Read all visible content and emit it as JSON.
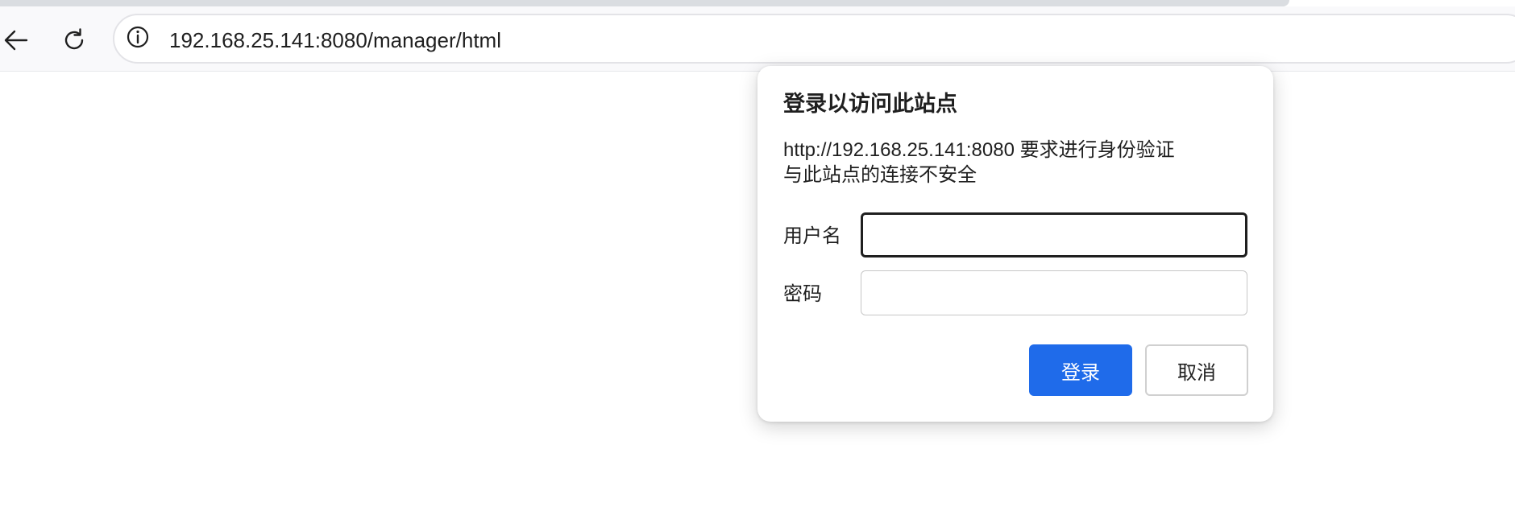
{
  "toolbar": {
    "back_icon": "back-arrow-icon",
    "reload_icon": "reload-icon",
    "site_info_icon": "info-icon",
    "url": "192.168.25.141:8080/manager/html"
  },
  "auth_dialog": {
    "title": "登录以访问此站点",
    "message_line1": "http://192.168.25.141:8080 要求进行身份验证",
    "message_line2": "与此站点的连接不安全",
    "username_label": "用户名",
    "username_value": "",
    "password_label": "密码",
    "password_value": "",
    "login_label": "登录",
    "cancel_label": "取消"
  },
  "colors": {
    "primary_button": "#1f6bea",
    "focus_border": "#1f1f1f",
    "toolbar_bg": "#f9f9fb"
  }
}
